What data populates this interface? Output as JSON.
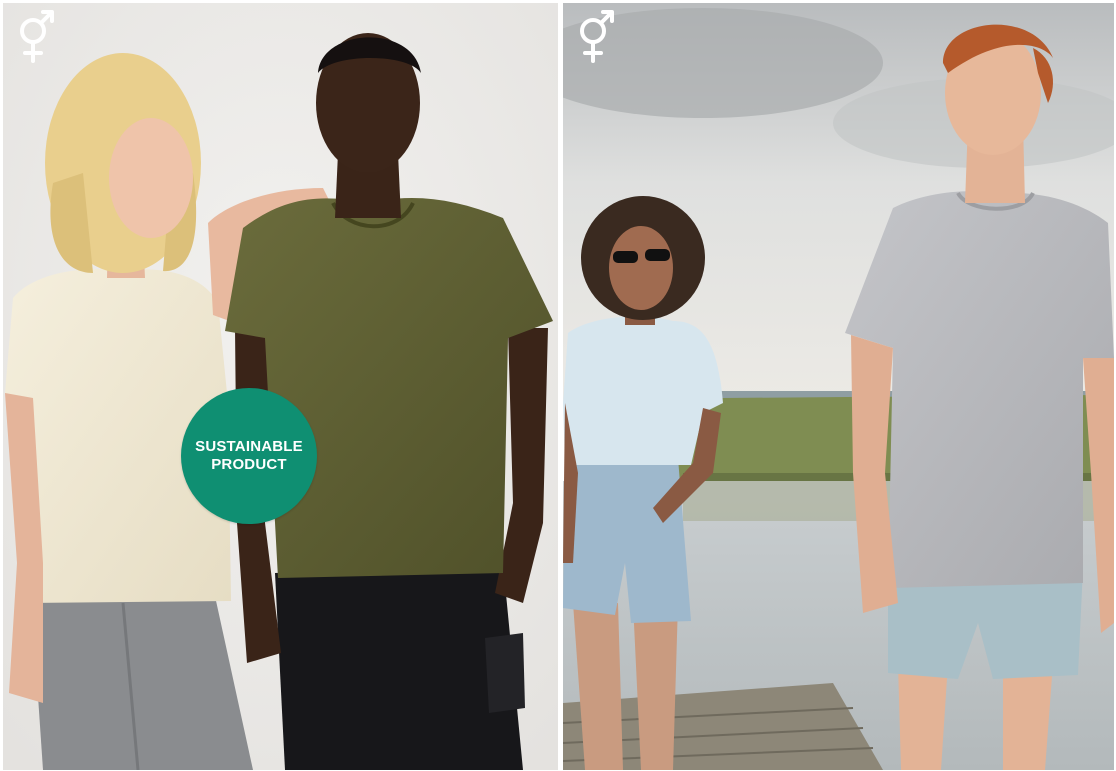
{
  "badge": {
    "line1": "SUSTAINABLE",
    "line2": "PRODUCT",
    "color": "#0f8f72"
  },
  "icons": {
    "gender_icon": "unisex-icon"
  },
  "colors": {
    "icon_white": "#ffffff",
    "studio_background": "#ecebea",
    "olive_shirt": "#5e5e33",
    "cream_shirt": "#efe8d3",
    "light_blue_shirt": "#d7e6ee",
    "grey_shirt": "#b7b8bd"
  }
}
